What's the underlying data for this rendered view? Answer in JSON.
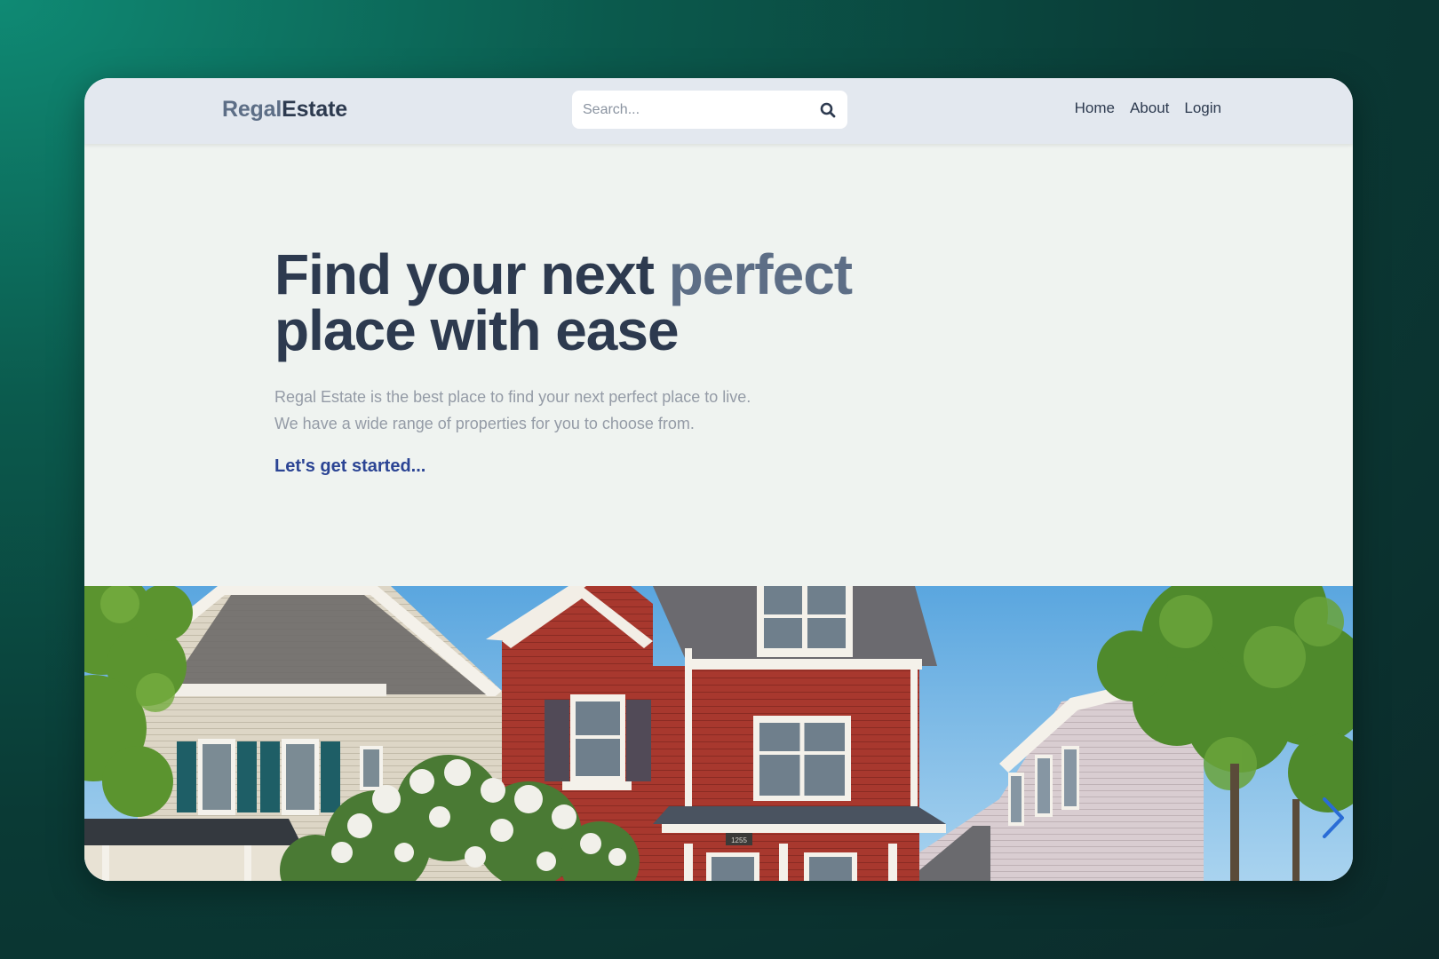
{
  "navbar": {
    "logo_part1": "Regal",
    "logo_part2": "Estate",
    "search_placeholder": "Search...",
    "links": [
      "Home",
      "About",
      "Login"
    ]
  },
  "hero": {
    "title_part1": "Find your next ",
    "title_accent": "perfect",
    "title_part2": "place with ease",
    "description_line1": "Regal Estate is the best place to find your next perfect place to live.",
    "description_line2": "We have a wide range of properties for you to choose from.",
    "cta": "Let's get started...",
    "house_number": "1255"
  },
  "carousel": {
    "next_icon": "chevron-right-icon",
    "arrow_color": "#2a6cd6"
  },
  "colors": {
    "primary_text": "#2d3a4f",
    "accent_text": "#5d6e86",
    "cta": "#2b4494"
  }
}
